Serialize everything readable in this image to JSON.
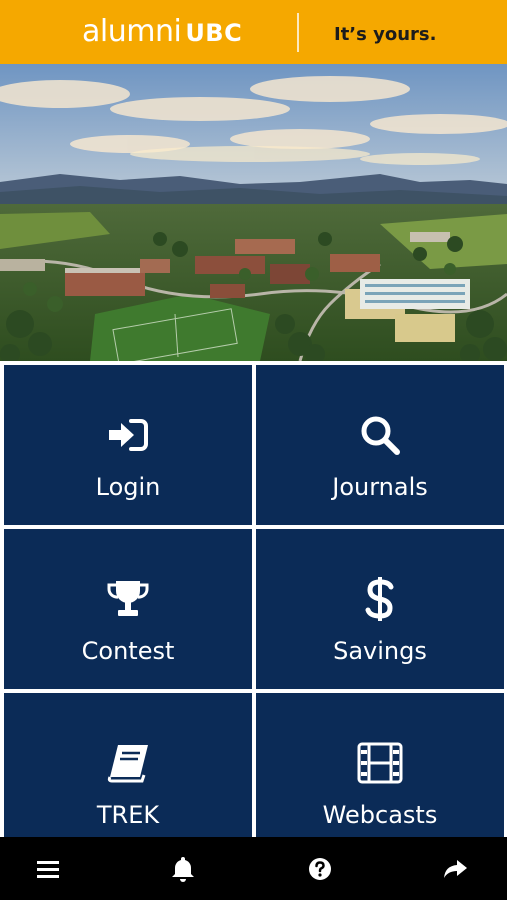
{
  "header": {
    "logo_alumni": "alumni",
    "logo_ubc": "UBC",
    "tagline": "It’s yours."
  },
  "hero": {
    "image": "aerial-campus-photo"
  },
  "tiles": [
    {
      "label": "Login",
      "icon": "sign-in-icon"
    },
    {
      "label": "Journals",
      "icon": "search-icon"
    },
    {
      "label": "Contest",
      "icon": "trophy-icon"
    },
    {
      "label": "Savings",
      "icon": "dollar-icon"
    },
    {
      "label": "TREK",
      "icon": "book-icon"
    },
    {
      "label": "Webcasts",
      "icon": "film-icon"
    }
  ],
  "bottom_bar": [
    {
      "icon": "menu-icon"
    },
    {
      "icon": "bell-icon"
    },
    {
      "icon": "help-icon"
    },
    {
      "icon": "share-icon"
    }
  ],
  "colors": {
    "header_bg": "#f5a800",
    "tile_bg": "#0b2b57",
    "bottom_bar_bg": "#000000"
  }
}
